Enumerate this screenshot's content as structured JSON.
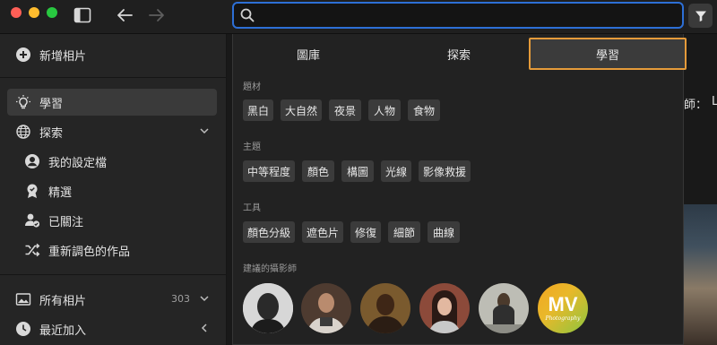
{
  "titlebar": {
    "search": {
      "placeholder": "",
      "value": ""
    },
    "icons": [
      "close-light",
      "minimize-light",
      "zoom-light",
      "sidebar-toggle-icon",
      "back-arrow-icon",
      "forward-arrow-icon",
      "filter-icon"
    ]
  },
  "sidebar": {
    "add_photo": "新增相片",
    "learn": "學習",
    "discover": "探索",
    "my_profile": "我的設定檔",
    "featured": "精選",
    "following": "已關注",
    "remixed": "重新調色的作品",
    "all_photos": "所有相片",
    "all_photos_count": "303",
    "recently_added": "最近加入"
  },
  "main": {
    "partial_text": "師：",
    "partial_letter": "L"
  },
  "panel": {
    "tabs": {
      "library": "圖庫",
      "discover": "探索",
      "learn": "學習"
    },
    "subjects": {
      "title": "題材",
      "chips": [
        "黑白",
        "大自然",
        "夜景",
        "人物",
        "食物"
      ]
    },
    "topics": {
      "title": "主題",
      "chips": [
        "中等程度",
        "顏色",
        "構圖",
        "光線",
        "影像救援"
      ]
    },
    "tools": {
      "title": "工具",
      "chips": [
        "顏色分級",
        "遮色片",
        "修復",
        "細節",
        "曲線"
      ]
    },
    "photographers": {
      "title": "建議的攝影師",
      "logo_text": "MV",
      "logo_sub": "Photography"
    }
  },
  "colors": {
    "accent_orange": "#e59b3a",
    "search_border": "#2d6fd6",
    "close": "#fe5f57",
    "minimize": "#febc2e",
    "zoom": "#28c840"
  }
}
